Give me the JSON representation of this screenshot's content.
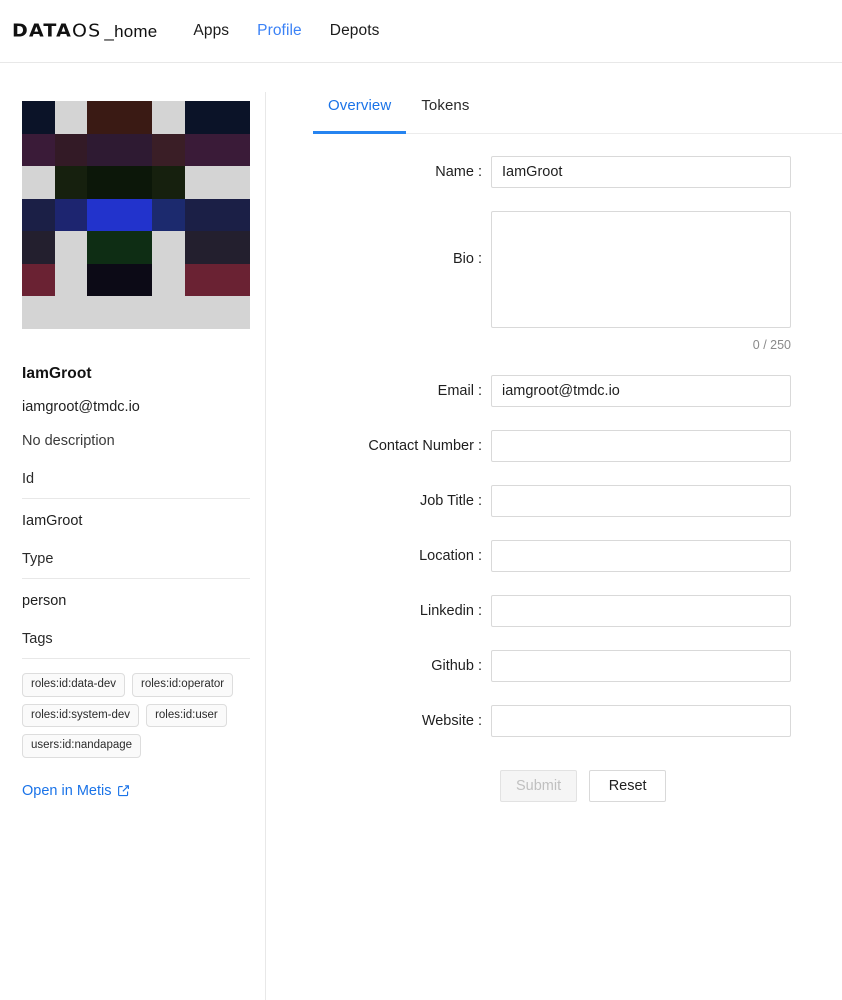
{
  "header": {
    "logo": {
      "data": "DATA",
      "os": "OS",
      "home": "_home"
    },
    "nav": [
      {
        "label": "Apps",
        "active": false
      },
      {
        "label": "Profile",
        "active": true
      },
      {
        "label": "Depots",
        "active": false
      }
    ]
  },
  "sidebar": {
    "avatar_name": "identicon-avatar",
    "avatar_background": "#d4d4d4",
    "avatar_cells": [
      "#0b1328",
      "#d4d4d4",
      "#3a1a14",
      "#3a1a14",
      "#d4d4d4",
      "#0b1328",
      "#0b1328",
      "#3a1b38",
      "#331a26",
      "#2e1a32",
      "#2e1a32",
      "#3a1e26",
      "#3a1b38",
      "#3a1b38",
      "#d4d4d4",
      "#16200e",
      "#0c1709",
      "#0c1709",
      "#16200e",
      "#d4d4d4",
      "#d4d4d4",
      "#1b1f46",
      "#1d2570",
      "#2233cc",
      "#2233cc",
      "#1c2a6e",
      "#1b1f46",
      "#1b1f46",
      "#231f2e",
      "#d4d4d4",
      "#0e2d14",
      "#0e2d14",
      "#d4d4d4",
      "#231f2e",
      "#231f2e",
      "#6a2233",
      "#d4d4d4",
      "#0c0a16",
      "#0c0a16",
      "#d4d4d4",
      "#6a2233",
      "#6a2233",
      "#d4d4d4",
      "#d4d4d4",
      "#d4d4d4",
      "#d4d4d4",
      "#d4d4d4",
      "#d4d4d4",
      "#d4d4d4"
    ],
    "avatar_rows_lower": [
      "#120b09",
      "#d4d4d4",
      "#d4d4d4",
      "#d4d4d4",
      "#d4d4d4",
      "#120b09",
      "#120b09",
      "#d4d4d4",
      "#3d1620",
      "#d4d4d4",
      "#d4d4d4",
      "#3d1620",
      "#d4d4d4",
      "#d4d4d4",
      "#d4d4d4",
      "#d4d4d4",
      "#d4d4d4",
      "#d4d4d4",
      "#d4d4d4",
      "#d4d4d4",
      "#d4d4d4",
      "#2a1711",
      "#d4d4d4",
      "#16200e",
      "#16200e",
      "#d4d4d4",
      "#2a1711",
      "#2a1711",
      "#3a2013",
      "#d4d4d4",
      "#111823",
      "#111823",
      "#d4d4d4",
      "#3a2013",
      "#3a2013"
    ],
    "name": "IamGroot",
    "email": "iamgroot@tmdc.io",
    "description": "No description",
    "id_label": "Id",
    "id_value": "IamGroot",
    "type_label": "Type",
    "type_value": "person",
    "tags_label": "Tags",
    "tags": [
      "roles:id:data-dev",
      "roles:id:operator",
      "roles:id:system-dev",
      "roles:id:user",
      "users:id:nandapage"
    ],
    "metis_link": "Open in Metis",
    "link_color": "#1a73e8"
  },
  "main": {
    "tabs": [
      {
        "label": "Overview",
        "active": true
      },
      {
        "label": "Tokens",
        "active": false
      }
    ],
    "accent_color": "#2684f0",
    "fields": [
      {
        "label": "Name :",
        "value": "IamGroot",
        "placeholder": ""
      },
      {
        "label": "Email :",
        "value": "iamgroot@tmdc.io",
        "placeholder": ""
      },
      {
        "label": "Contact Number :",
        "value": "",
        "placeholder": ""
      },
      {
        "label": "Job Title :",
        "value": "",
        "placeholder": ""
      },
      {
        "label": "Location :",
        "value": "",
        "placeholder": ""
      },
      {
        "label": "Linkedin :",
        "value": "",
        "placeholder": ""
      },
      {
        "label": "Github :",
        "value": "",
        "placeholder": ""
      },
      {
        "label": "Website :",
        "value": "",
        "placeholder": ""
      }
    ],
    "bio": {
      "label": "Bio :",
      "value": "",
      "placeholder": "",
      "counter": "0 / 250"
    },
    "buttons": {
      "submit": {
        "label": "Submit",
        "disabled": true
      },
      "reset": {
        "label": "Reset",
        "disabled": false
      }
    }
  }
}
